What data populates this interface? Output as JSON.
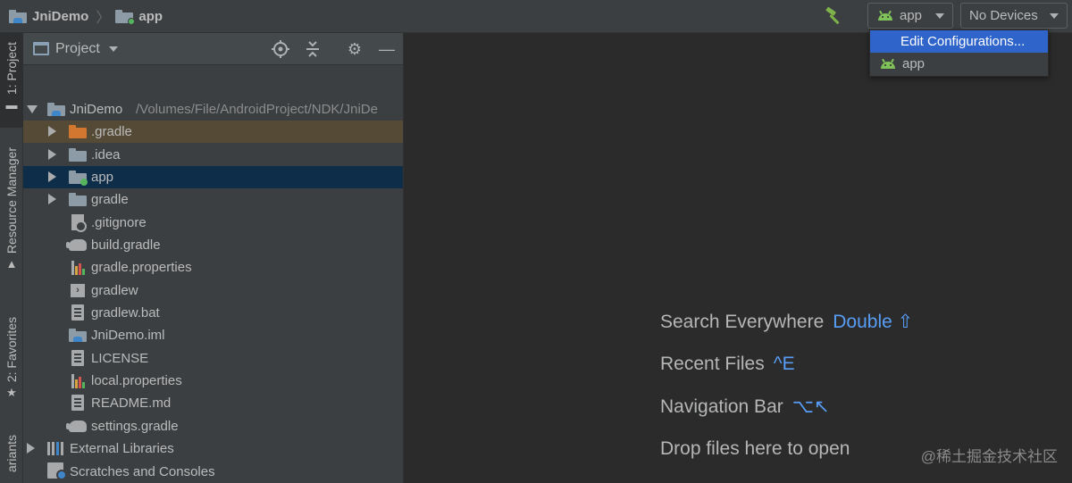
{
  "breadcrumb": {
    "project": "JniDemo",
    "module": "app"
  },
  "toolbar": {
    "build_icon": "hammer-icon",
    "run_config": "app",
    "device": "No Devices"
  },
  "config_popup": {
    "items": [
      {
        "label": "Edit Configurations...",
        "selected": true
      },
      {
        "label": "app",
        "selected": false
      }
    ]
  },
  "tool_strip": {
    "project_tab": "1: Project",
    "resource_tab": "Resource Manager",
    "favorites_tab": "2: Favorites",
    "variants_tab": "ariants"
  },
  "project_panel": {
    "title": "Project",
    "root": {
      "name": "JniDemo",
      "path": "/Volumes/File/AndroidProject/NDK/JniDe"
    },
    "items": [
      {
        "name": ".gradle",
        "kind": "folder-orange"
      },
      {
        "name": ".idea",
        "kind": "folder"
      },
      {
        "name": "app",
        "kind": "module"
      },
      {
        "name": "gradle",
        "kind": "folder"
      },
      {
        "name": ".gitignore",
        "kind": "ignore-file"
      },
      {
        "name": "build.gradle",
        "kind": "gradle-file"
      },
      {
        "name": "gradle.properties",
        "kind": "properties-file"
      },
      {
        "name": "gradlew",
        "kind": "shell-file"
      },
      {
        "name": "gradlew.bat",
        "kind": "text-file"
      },
      {
        "name": "JniDemo.iml",
        "kind": "iml-file"
      },
      {
        "name": "LICENSE",
        "kind": "text-file"
      },
      {
        "name": "local.properties",
        "kind": "properties-file"
      },
      {
        "name": "README.md",
        "kind": "text-file"
      },
      {
        "name": "settings.gradle",
        "kind": "gradle-file"
      }
    ],
    "external_libraries": "External Libraries",
    "scratches": "Scratches and Consoles"
  },
  "editor": {
    "hints": [
      {
        "label": "Search Everywhere",
        "key": "Double ⇧"
      },
      {
        "label": "Recent Files",
        "key": "^E"
      },
      {
        "label": "Navigation Bar",
        "key": "⌥↖"
      },
      {
        "label": "Drop files here to open",
        "key": ""
      }
    ],
    "watermark": "@稀土掘金技术社区"
  },
  "colors": {
    "accent": "#2f65ca",
    "selection": "#0e2d49",
    "key_hint": "#589df6",
    "android_green": "#7fc25a"
  }
}
